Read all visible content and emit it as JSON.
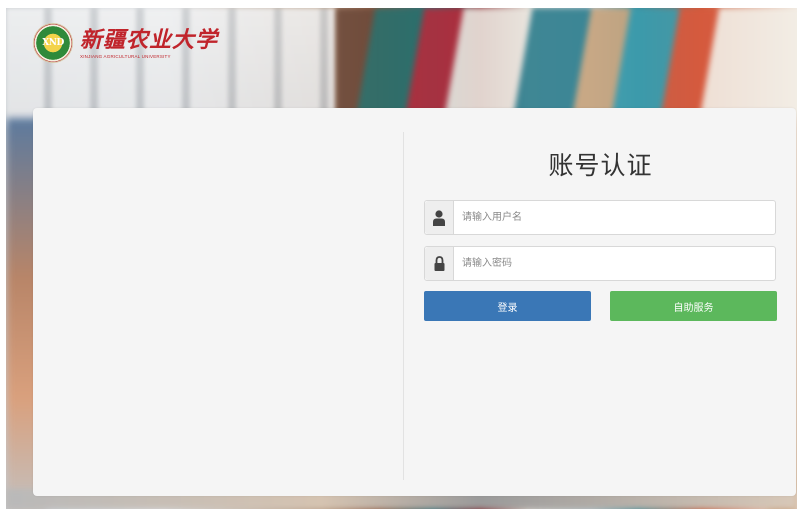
{
  "header": {
    "logo_cn": "新疆农业大学",
    "logo_en": "XINJIANG AGRICULTURAL UNIVERSITY",
    "emblem_text": "XND"
  },
  "login": {
    "title": "账号认证",
    "username_placeholder": "请输入用户名",
    "password_placeholder": "请输入密码",
    "login_label": "登录",
    "service_label": "自助服务"
  },
  "icons": {
    "user": "user-icon",
    "lock": "lock-icon"
  },
  "colors": {
    "login_button": "#3a77b6",
    "service_button": "#5cb85c",
    "logo_red": "#c0242b",
    "panel_bg": "#f5f5f5"
  }
}
